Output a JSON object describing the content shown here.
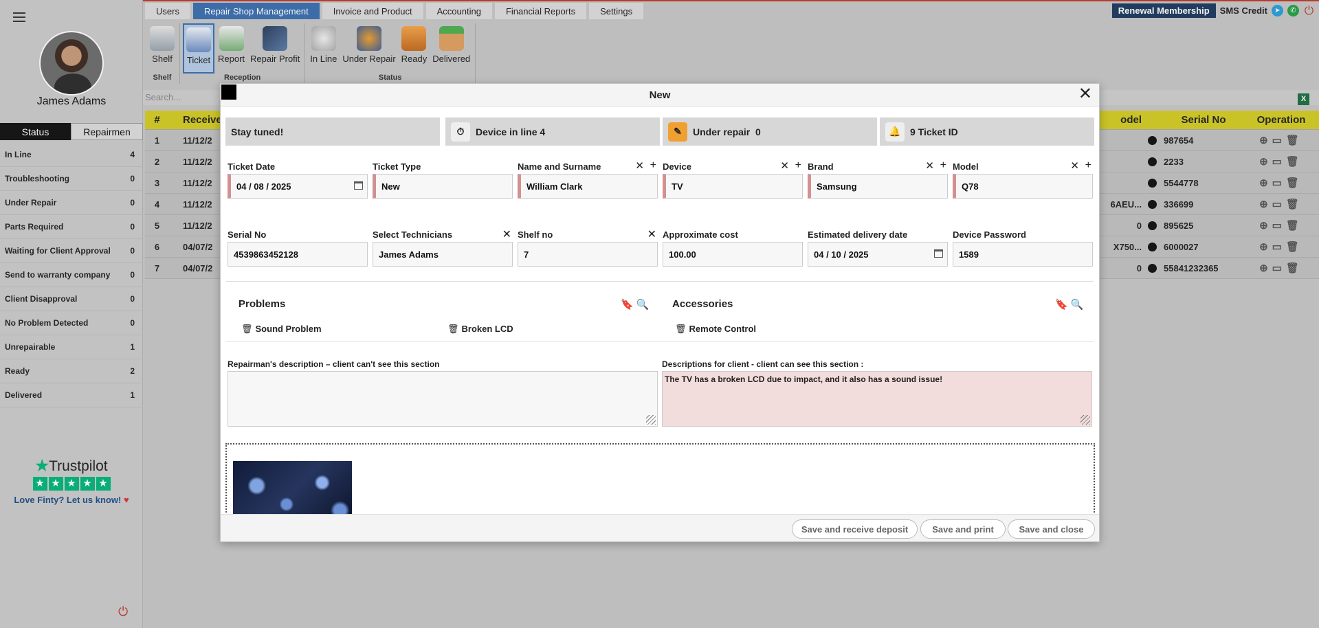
{
  "user": {
    "name": "James Adams"
  },
  "sidebar": {
    "tabs": [
      "Status",
      "Repairmen"
    ],
    "items": [
      {
        "label": "In Line",
        "count": "4"
      },
      {
        "label": "Troubleshooting",
        "count": "0"
      },
      {
        "label": "Under Repair",
        "count": "0"
      },
      {
        "label": "Parts Required",
        "count": "0"
      },
      {
        "label": "Waiting for Client Approval",
        "count": "0"
      },
      {
        "label": "Send to warranty company",
        "count": "0"
      },
      {
        "label": "Client Disapproval",
        "count": "0"
      },
      {
        "label": "No Problem Detected",
        "count": "0"
      },
      {
        "label": "Unrepairable",
        "count": "1"
      },
      {
        "label": "Ready",
        "count": "2"
      },
      {
        "label": "Delivered",
        "count": "1"
      }
    ],
    "trustpilot": {
      "brand": "Trustpilot",
      "cta": "Love Finty? Let us know!"
    }
  },
  "nav": {
    "tabs": [
      "Users",
      "Repair Shop Management",
      "Invoice and Product",
      "Accounting",
      "Financial Reports",
      "Settings"
    ],
    "renew": "Renewal Membership",
    "sms": "SMS Credit"
  },
  "ribbon": {
    "groups": [
      {
        "label": "Shelf",
        "buttons": [
          "Shelf"
        ]
      },
      {
        "label": "Reception",
        "buttons": [
          "Ticket",
          "Report",
          "Repair Profit"
        ]
      },
      {
        "label": "Status",
        "buttons": [
          "In Line",
          "Under Repair",
          "Ready",
          "Delivered"
        ]
      }
    ]
  },
  "table": {
    "search_placeholder": "Search...",
    "headers": {
      "num": "#",
      "received": "Received",
      "model": "odel",
      "serial": "Serial No",
      "operation": "Operation"
    },
    "rows": [
      {
        "num": "1",
        "received": "11/12/2",
        "model": "",
        "serial": "987654"
      },
      {
        "num": "2",
        "received": "11/12/2",
        "model": "",
        "serial": "2233"
      },
      {
        "num": "3",
        "received": "11/12/2",
        "model": "",
        "serial": "5544778"
      },
      {
        "num": "4",
        "received": "11/12/2",
        "model": "6AEU...",
        "serial": "336699"
      },
      {
        "num": "5",
        "received": "11/12/2",
        "model": "0",
        "serial": "895625"
      },
      {
        "num": "6",
        "received": "04/07/2",
        "model": "X750...",
        "serial": "6000027"
      },
      {
        "num": "7",
        "received": "04/07/2",
        "model": "0",
        "serial": "55841232365"
      }
    ]
  },
  "modal": {
    "title": "New",
    "info": [
      "Stay tuned!",
      "Device in line 4",
      "Under repair  0",
      "9 Ticket ID"
    ],
    "fields_row1": [
      {
        "label": "Ticket Date",
        "value": "04 / 08 / 2025"
      },
      {
        "label": "Ticket Type",
        "value": "New"
      },
      {
        "label": "Name and Surname",
        "value": "William Clark"
      },
      {
        "label": "Device",
        "value": "TV"
      },
      {
        "label": "Brand",
        "value": "Samsung"
      },
      {
        "label": "Model",
        "value": "Q78"
      }
    ],
    "fields_row2": [
      {
        "label": "Serial No",
        "value": "4539863452128"
      },
      {
        "label": "Select Technicians",
        "value": "James Adams"
      },
      {
        "label": "Shelf no",
        "value": "7"
      },
      {
        "label": "Approximate cost",
        "value": "100.00"
      },
      {
        "label": "Estimated delivery date",
        "value": "04 / 10 / 2025"
      },
      {
        "label": "Device Password",
        "value": "1589"
      }
    ],
    "problems": {
      "title": "Problems",
      "items": [
        "Sound Problem",
        "Broken LCD"
      ]
    },
    "accessories": {
      "title": "Accessories",
      "items": [
        "Remote Control"
      ]
    },
    "repair_desc_label": "Repairman's description – client can't see this section",
    "repair_desc_value": "",
    "client_desc_label": "Descriptions for client - client can see this section :",
    "client_desc_value": "The TV has a broken LCD due to impact, and it also has a sound issue!",
    "buttons": {
      "deposit": "Save and receive deposit",
      "print": "Save and print",
      "close": "Save and close"
    }
  },
  "colors": {
    "accent": "#3a6fb0",
    "header_yellow": "#d4cc23",
    "trustpilot": "#00b67a",
    "required": "#d39090"
  }
}
